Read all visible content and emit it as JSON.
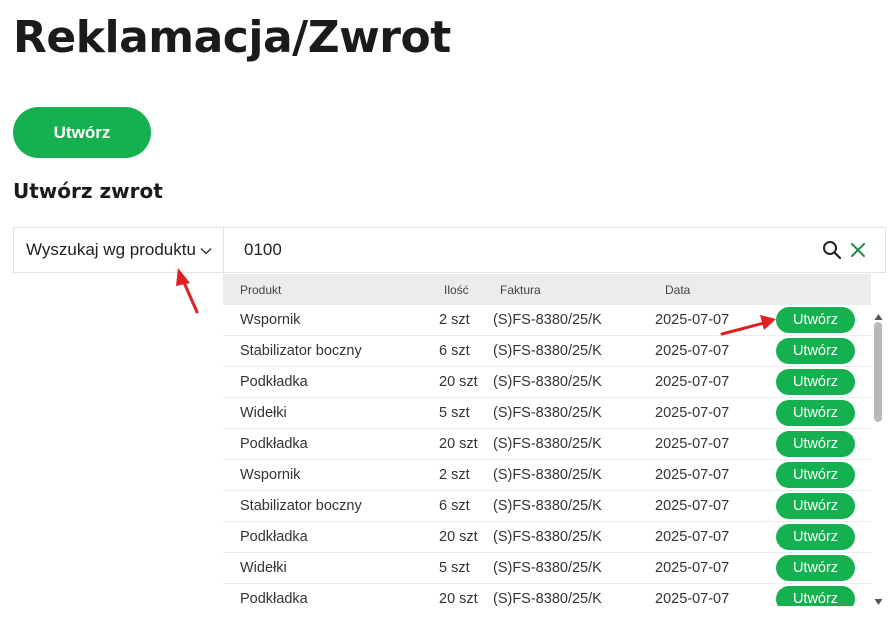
{
  "page": {
    "title": "Reklamacja/Zwrot"
  },
  "toolbar": {
    "create_label": "Utwórz"
  },
  "section": {
    "title": "Utwórz zwrot"
  },
  "search": {
    "mode_label": "Wyszukaj wg produktu",
    "mode_icon": "chevron-down-icon",
    "query": "0100",
    "search_icon": "search-icon",
    "clear_icon": "close-icon"
  },
  "table": {
    "columns": [
      "Produkt",
      "Ilość",
      "Faktura",
      "Data"
    ],
    "rows": [
      {
        "product": "Wspornik",
        "qty": "2 szt",
        "invoice": "(S)FS-8380/25/K",
        "date": "2025-07-07",
        "action": "Utwórz"
      },
      {
        "product": "Stabilizator boczny",
        "qty": "6 szt",
        "invoice": "(S)FS-8380/25/K",
        "date": "2025-07-07",
        "action": "Utwórz"
      },
      {
        "product": "Podkładka",
        "qty": "20 szt",
        "invoice": "(S)FS-8380/25/K",
        "date": "2025-07-07",
        "action": "Utwórz"
      },
      {
        "product": "Widełki",
        "qty": "5 szt",
        "invoice": "(S)FS-8380/25/K",
        "date": "2025-07-07",
        "action": "Utwórz"
      },
      {
        "product": "Podkładka",
        "qty": "20 szt",
        "invoice": "(S)FS-8380/25/K",
        "date": "2025-07-07",
        "action": "Utwórz"
      },
      {
        "product": "Wspornik",
        "qty": "2 szt",
        "invoice": "(S)FS-8380/25/K",
        "date": "2025-07-07",
        "action": "Utwórz"
      },
      {
        "product": "Stabilizator boczny",
        "qty": "6 szt",
        "invoice": "(S)FS-8380/25/K",
        "date": "2025-07-07",
        "action": "Utwórz"
      },
      {
        "product": "Podkładka",
        "qty": "20 szt",
        "invoice": "(S)FS-8380/25/K",
        "date": "2025-07-07",
        "action": "Utwórz"
      },
      {
        "product": "Widełki",
        "qty": "5 szt",
        "invoice": "(S)FS-8380/25/K",
        "date": "2025-07-07",
        "action": "Utwórz"
      },
      {
        "product": "Podkładka",
        "qty": "20 szt",
        "invoice": "(S)FS-8380/25/K",
        "date": "2025-07-07",
        "action": "Utwórz"
      }
    ]
  },
  "colors": {
    "accent": "#15b150",
    "annotation": "#e02020",
    "header_bg": "#ececec"
  }
}
